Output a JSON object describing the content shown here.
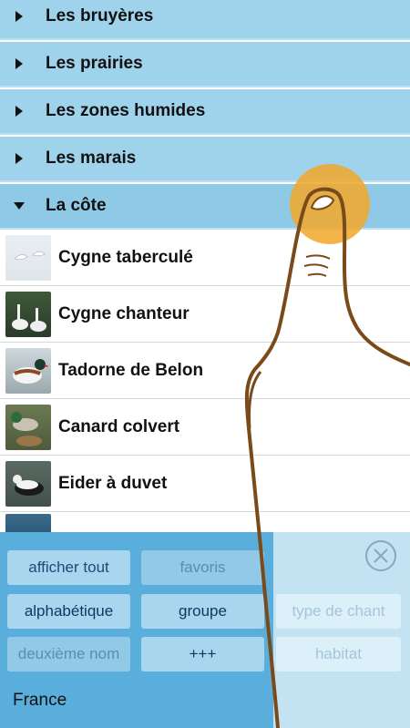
{
  "categories": [
    {
      "label": "Les bruyères",
      "expanded": false
    },
    {
      "label": "Les prairies",
      "expanded": false
    },
    {
      "label": "Les zones humides",
      "expanded": false
    },
    {
      "label": "Les marais",
      "expanded": false
    },
    {
      "label": "La côte",
      "expanded": true
    }
  ],
  "birds": [
    {
      "name": "Cygne taberculé"
    },
    {
      "name": "Cygne chanteur"
    },
    {
      "name": "Tadorne de Belon"
    },
    {
      "name": "Canard colvert"
    },
    {
      "name": "Eider à duvet"
    }
  ],
  "filters": {
    "show_all": "afficher tout",
    "favorites": "favoris",
    "alphabetical": "alphabétique",
    "group": "groupe",
    "song_type": "type de chant",
    "second_name": "deuxième nom",
    "more": "+++",
    "habitat": "habitat"
  },
  "region": "France",
  "icons": {
    "expand": "triangle-right-icon",
    "collapse": "triangle-down-icon",
    "close": "close-circle-icon"
  },
  "colors": {
    "category_bg": "#9fd3ec",
    "panel_bg": "#5aaedc",
    "touch_indicator": "#f0a830",
    "hand_outline": "#7a4a1a"
  }
}
